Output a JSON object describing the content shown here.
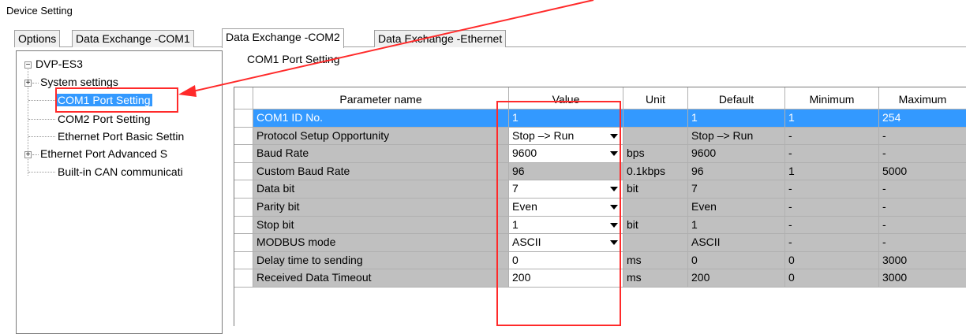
{
  "window": {
    "title": "Device Setting"
  },
  "tabs": [
    {
      "label": "Options",
      "active": false
    },
    {
      "label": "Data Exchange -COM1",
      "active": false
    },
    {
      "label": "Data Exchange -COM2",
      "active": true
    },
    {
      "label": "Data Exchange -Ethernet",
      "active": false
    }
  ],
  "tree": {
    "root": "DVP-ES3",
    "items": [
      {
        "label": "System settings",
        "expandable": true
      },
      {
        "label": "COM1 Port Setting",
        "expandable": false,
        "selected": true
      },
      {
        "label": "COM2 Port Setting",
        "expandable": false
      },
      {
        "label": "Ethernet Port Basic Settin",
        "expandable": false
      },
      {
        "label": "Ethernet Port Advanced S",
        "expandable": true
      },
      {
        "label": "Built-in CAN communicati",
        "expandable": false
      }
    ]
  },
  "section_title": "COM1 Port Setting",
  "table": {
    "columns": [
      "Parameter name",
      "Value",
      "Unit",
      "Default",
      "Minimum",
      "Maximum"
    ],
    "rows": [
      {
        "name": "COM1 ID No.",
        "value": "1",
        "unit": "",
        "default": "1",
        "min": "1",
        "max": "254",
        "dropdown": false,
        "editable": false,
        "selected": true
      },
      {
        "name": "Protocol Setup Opportunity",
        "value": "Stop –> Run",
        "unit": "",
        "default": "Stop –> Run",
        "min": "-",
        "max": "-",
        "dropdown": true,
        "editable": true,
        "selected": false
      },
      {
        "name": "Baud Rate",
        "value": "9600",
        "unit": "bps",
        "default": "9600",
        "min": "-",
        "max": "-",
        "dropdown": true,
        "editable": true,
        "selected": false
      },
      {
        "name": "Custom Baud Rate",
        "value": "96",
        "unit": "0.1kbps",
        "default": "96",
        "min": "1",
        "max": "5000",
        "dropdown": false,
        "editable": false,
        "selected": false
      },
      {
        "name": "Data bit",
        "value": "7",
        "unit": "bit",
        "default": "7",
        "min": "-",
        "max": "-",
        "dropdown": true,
        "editable": true,
        "selected": false
      },
      {
        "name": "Parity bit",
        "value": "Even",
        "unit": "",
        "default": "Even",
        "min": "-",
        "max": "-",
        "dropdown": true,
        "editable": true,
        "selected": false
      },
      {
        "name": "Stop bit",
        "value": "1",
        "unit": "bit",
        "default": "1",
        "min": "-",
        "max": "-",
        "dropdown": true,
        "editable": true,
        "selected": false
      },
      {
        "name": "MODBUS mode",
        "value": "ASCII",
        "unit": "",
        "default": "ASCII",
        "min": "-",
        "max": "-",
        "dropdown": true,
        "editable": true,
        "selected": false
      },
      {
        "name": "Delay time to sending",
        "value": "0",
        "unit": "ms",
        "default": "0",
        "min": "0",
        "max": "3000",
        "dropdown": false,
        "editable": true,
        "selected": false
      },
      {
        "name": "Received Data Timeout",
        "value": "200",
        "unit": "ms",
        "default": "200",
        "min": "0",
        "max": "3000",
        "dropdown": false,
        "editable": true,
        "selected": false
      }
    ]
  },
  "colors": {
    "selection": "#3399ff",
    "readonly_cell": "#c0c0c0",
    "annotation": "#ff2a2a"
  }
}
